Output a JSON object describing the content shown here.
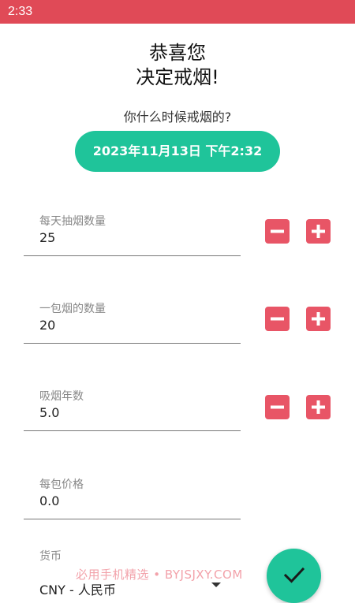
{
  "status_bar": {
    "time": "2:33"
  },
  "header": {
    "title_line1": "恭喜您",
    "title_line2": "决定戒烟!"
  },
  "quit_question": "你什么时候戒烟的?",
  "quit_datetime": "2023年11月13日 下午2:32",
  "fields": [
    {
      "label": "每天抽烟数量",
      "value": "25"
    },
    {
      "label": "一包烟的数量",
      "value": "20"
    },
    {
      "label": "吸烟年数",
      "value": "5.0"
    },
    {
      "label": "每包价格",
      "value": "0.0"
    },
    {
      "label": "货币",
      "value": "CNY - 人民币"
    }
  ],
  "watermark": "必用手机精选 • BYJSJXY.COM",
  "icons": {
    "minus": "minus-icon",
    "plus": "plus-icon",
    "dropdown": "dropdown-arrow-icon",
    "confirm": "check-icon"
  },
  "colors": {
    "status_bar": "#e04a57",
    "accent_green": "#1fc49a",
    "stepper_red": "#e85566"
  }
}
